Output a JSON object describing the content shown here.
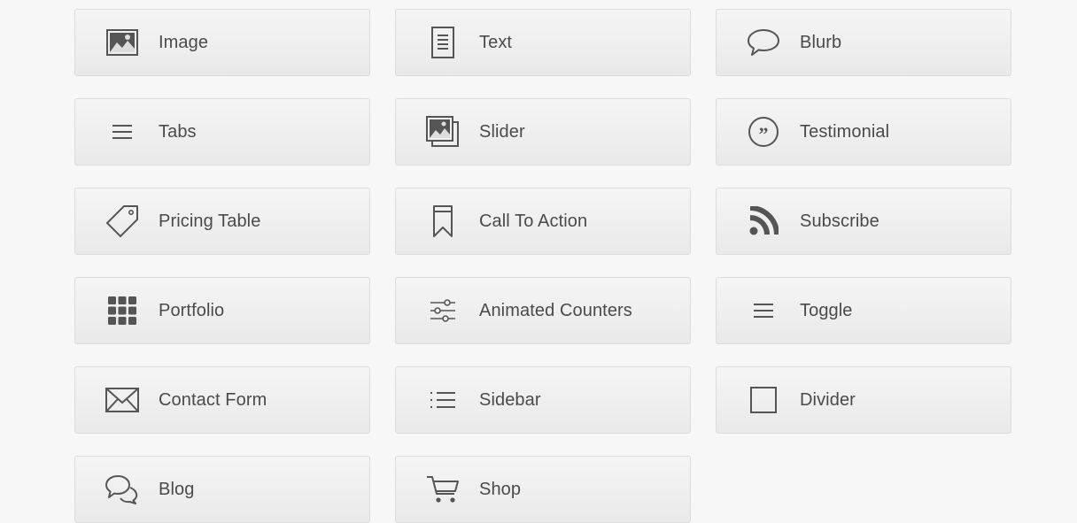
{
  "modules": [
    {
      "label": "Image",
      "icon": "image-icon"
    },
    {
      "label": "Text",
      "icon": "text-document-icon"
    },
    {
      "label": "Blurb",
      "icon": "speech-bubble-icon"
    },
    {
      "label": "Tabs",
      "icon": "hamburger-lines-icon"
    },
    {
      "label": "Slider",
      "icon": "stacked-images-icon"
    },
    {
      "label": "Testimonial",
      "icon": "quote-circle-icon"
    },
    {
      "label": "Pricing Table",
      "icon": "price-tag-icon"
    },
    {
      "label": "Call To Action",
      "icon": "bookmark-icon"
    },
    {
      "label": "Subscribe",
      "icon": "rss-icon"
    },
    {
      "label": "Portfolio",
      "icon": "grid-icon"
    },
    {
      "label": "Animated Counters",
      "icon": "sliders-icon"
    },
    {
      "label": "Toggle",
      "icon": "hamburger-lines-icon"
    },
    {
      "label": "Contact Form",
      "icon": "envelope-icon"
    },
    {
      "label": "Sidebar",
      "icon": "bulleted-list-icon"
    },
    {
      "label": "Divider",
      "icon": "square-outline-icon"
    },
    {
      "label": "Blog",
      "icon": "chat-bubbles-icon"
    },
    {
      "label": "Shop",
      "icon": "shopping-cart-icon"
    }
  ],
  "colors": {
    "background": "#f7f7f7",
    "tile_border": "#dcdcdc",
    "text": "#4a4a4a",
    "icon": "#555555"
  }
}
